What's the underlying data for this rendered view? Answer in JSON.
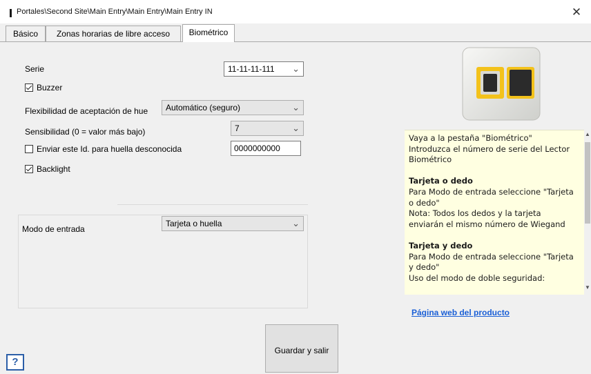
{
  "window": {
    "title": "Portales\\Second Site\\Main Entry\\Main Entry\\Main Entry IN",
    "close_glyph": "✕"
  },
  "tabs": [
    {
      "label": "Básico",
      "active": false
    },
    {
      "label": "Zonas horarias de libre acceso",
      "active": false
    },
    {
      "label": "Biométrico",
      "active": true
    }
  ],
  "form": {
    "serie_label": "Serie",
    "serie_value": "11-11-11-111",
    "buzzer_label": "Buzzer",
    "buzzer_checked": true,
    "flex_label": "Flexibilidad de aceptación de hue",
    "flex_value": "Automático (seguro)",
    "sens_label": "Sensibilidad (0 = valor más bajo)",
    "sens_value": "7",
    "unknown_id_label": "Enviar este Id. para huella desconocida",
    "unknown_id_checked": false,
    "unknown_id_value": "0000000000",
    "backlight_label": "Backlight",
    "backlight_checked": true,
    "mode_label": "Modo de entrada",
    "mode_value": "Tarjeta o huella"
  },
  "help_panel": {
    "intro_1": "Vaya a la pestaña \"Biométrico\"",
    "intro_2": "Introduzca el número de serie del Lector Biométrico",
    "section1_title": "Tarjeta o dedo",
    "section1_line1": "Para Modo de entrada seleccione \"Tarjeta o dedo\"",
    "section1_line2": "Nota: Todos los dedos y la tarjeta enviarán el mismo número de Wiegand",
    "section2_title": "Tarjeta y dedo",
    "section2_line1": "Para Modo de entrada seleccione \"Tarjeta y dedo\"",
    "section2_line2": "Uso del modo de doble seguridad:"
  },
  "product_link": "Página web del producto",
  "buttons": {
    "save_exit": "Guardar y salir",
    "help": "?"
  },
  "colors": {
    "help_background": "#ffffe1",
    "link": "#1a5fd6",
    "device_frame": "#f3c21b"
  }
}
